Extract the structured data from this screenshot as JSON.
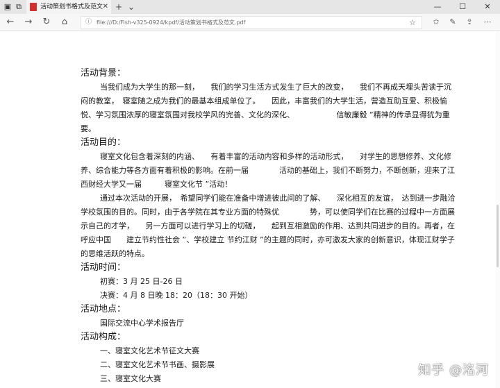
{
  "tab": {
    "title": "活动策划书格式及范文.p",
    "new_tab": "+",
    "dropdown": "⌄"
  },
  "window": {
    "minimize": "—",
    "maximize": "☐",
    "close": "✕"
  },
  "address": {
    "url": "file:///D:/Fish-v325-0924/kpdf/活动策划书格式及范文.pdf"
  },
  "document": {
    "h_background": "活动背景：",
    "background_paragraph": "当我们成为大学生的那一刻，　　我们的学习生活方式发生了巨大的改变，　　我们不再成天埋头苦读于沉闷的教室，　寝室随之成为我们的最基本组成单位了。　　因此，丰富我们的大学生活，营造互助互爱、积极愉悦、学习氛围浓厚的寝室氛围对我校学风的完善、文化的深化、　　　　　　信敏廉毅 ”精神的传承显得犹为重要。",
    "h_purpose": "活动目的：",
    "purpose_p1": "寝室文化包含着深刻的内涵、　　有着丰富的活动内容和多样的活动形式，　　对学生的思想修养、文化修养、综合能力等各方面有着积极的影响。在前一届　　　　活动的基础上，我们不断努力，不断创新，迎来了江西财经大学又一届　　　寝室文化节 ”活动！",
    "purpose_p2": "通过本次活动的开展，　希望同学们能在准备中增进彼此间的了解、　　深化相互的友谊，　达到进一步融洽学校氛围的目的。同时，由于各学院在其专业方面的特殊优　　　　势，可以使同学们在比赛的过程中一方面展示自己的才学，　　另一方面可以进行学习上的切磋，　　起到互相激励的作用、达到共同进步的目的。再者，在呼应中国　　建立节约性社会 ”、学校建立 节约江财 ”的主题的同时，亦可激发大家的创新意识，体现江财学子的思维活跃的特点。",
    "h_time": "活动时间：",
    "time_prelim": "初赛：3 月 25 日-26 日",
    "time_final": "决赛：4 月 8 日晚 18：20（18：30 开始）",
    "h_location": "活动地点：",
    "location": "国际交流中心学术报告厅",
    "h_structure": "活动构成：",
    "structure_items": [
      "一、寝室文化艺术节征文大赛",
      "二、寝室文化艺术节书画、摄影展",
      "三、寝室文化大赛"
    ]
  },
  "watermark": "知乎 @洺河"
}
